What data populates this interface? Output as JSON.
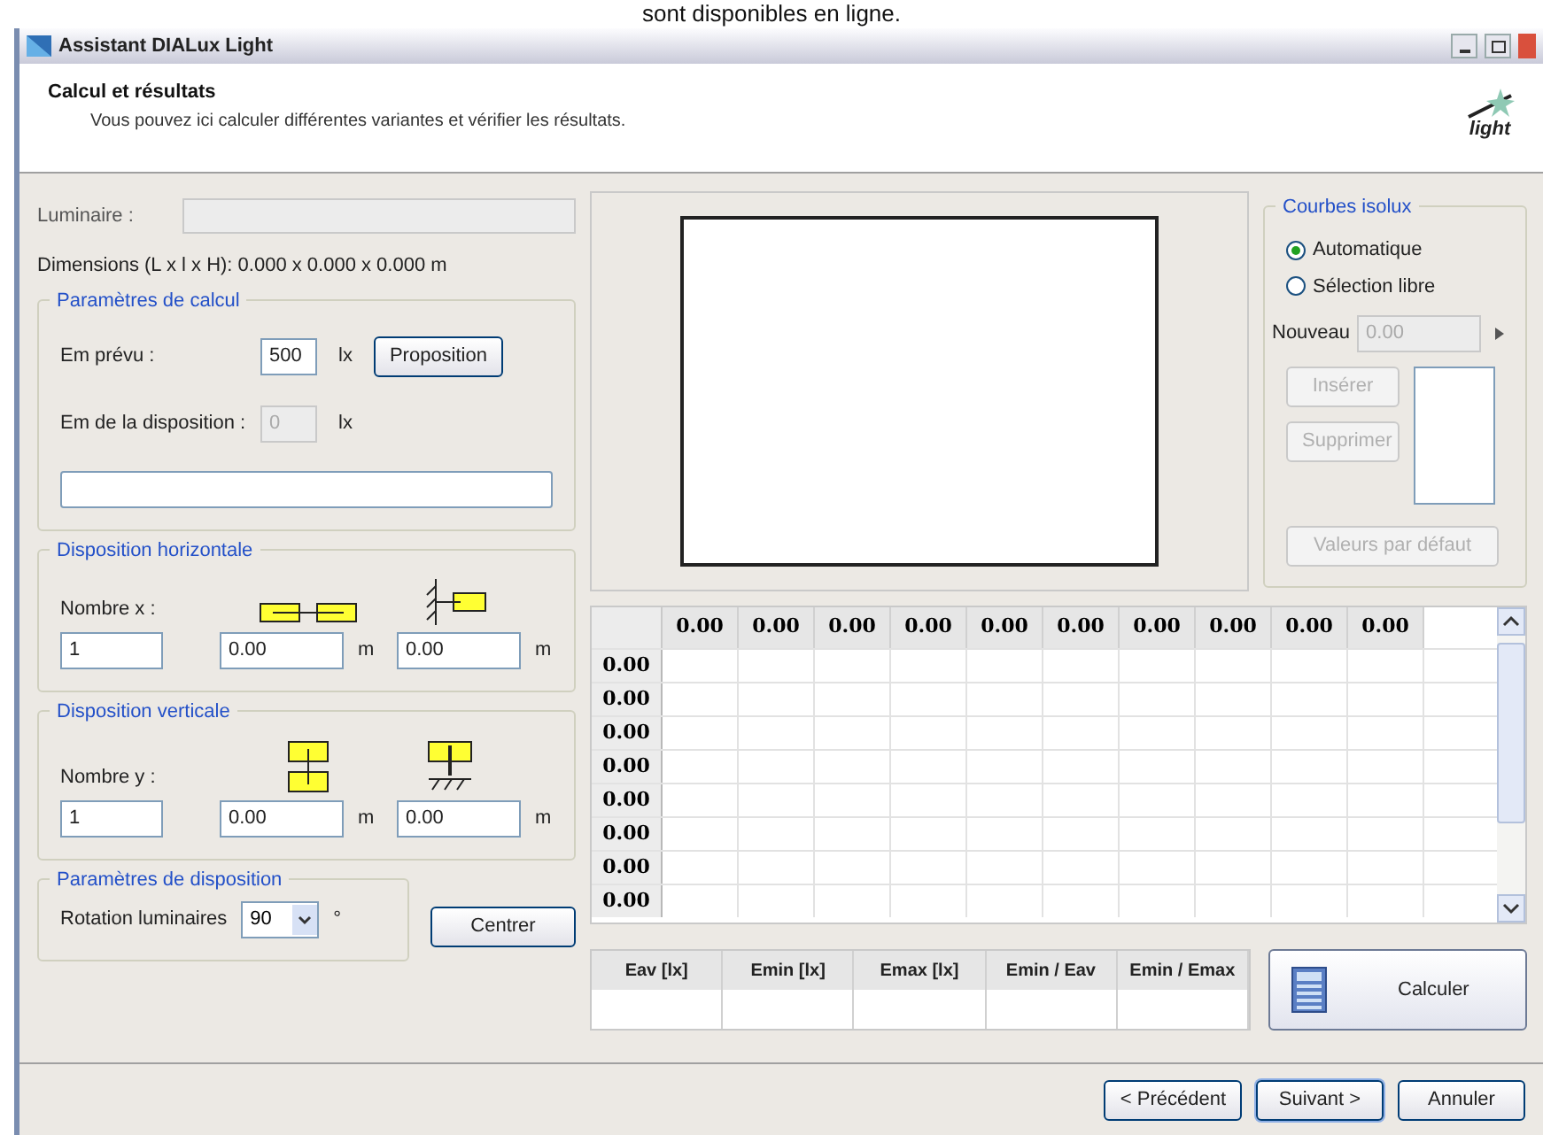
{
  "caption": "sont disponibles en ligne.",
  "window": {
    "title": "Assistant DIALux Light"
  },
  "header": {
    "title": "Calcul et résultats",
    "subtitle": "Vous pouvez ici calculer différentes variantes et vérifier les résultats.",
    "logo_text": "light"
  },
  "luminaire": {
    "label": "Luminaire :",
    "dimensions": "Dimensions (L x l x H): 0.000 x 0.000 x 0.000 m"
  },
  "calc_params": {
    "title": "Paramètres de calcul",
    "em_label": "Em prévu :",
    "em_value": "500",
    "em_unit": "lx",
    "proposal_button": "Proposition",
    "em_disp_label": "Em de la disposition :",
    "em_disp_value": "0",
    "em_disp_unit": "lx"
  },
  "horizontal": {
    "title": "Disposition horizontale",
    "count_label": "Nombre x :",
    "count": "1",
    "spacing": "0.00",
    "spacing_unit": "m",
    "wall": "0.00",
    "wall_unit": "m"
  },
  "vertical": {
    "title": "Disposition verticale",
    "count_label": "Nombre y :",
    "count": "1",
    "spacing": "0.00",
    "spacing_unit": "m",
    "wall": "0.00",
    "wall_unit": "m"
  },
  "layout_params": {
    "title": "Paramètres de disposition",
    "rotation_label": "Rotation luminaires",
    "rotation": "90",
    "rotation_unit": "°",
    "center_button": "Centrer"
  },
  "isolux": {
    "title": "Courbes isolux",
    "options": [
      {
        "label": "Automatique",
        "selected": true
      },
      {
        "label": "Sélection libre",
        "selected": false
      }
    ],
    "new_label": "Nouveau",
    "new_value": "0.00",
    "new_disabled": true,
    "insert": {
      "label": "Insérer",
      "disabled": true
    },
    "delete": {
      "label": "Supprimer",
      "disabled": true
    },
    "defaults": {
      "label": "Valeurs par défaut",
      "disabled": true
    }
  },
  "grid": {
    "columns": [
      "0.00",
      "0.00",
      "0.00",
      "0.00",
      "0.00",
      "0.00",
      "0.00",
      "0.00",
      "0.00",
      "0.00"
    ],
    "rows": [
      "0.00",
      "0.00",
      "0.00",
      "0.00",
      "0.00",
      "0.00",
      "0.00",
      "0.00"
    ]
  },
  "results": {
    "columns": [
      "Eav [lx]",
      "Emin [lx]",
      "Emax [lx]",
      "Emin / Eav",
      "Emin / Emax"
    ]
  },
  "calculate_button": "Calculer",
  "footer_buttons": [
    {
      "label": "< Précédent",
      "default": false
    },
    {
      "label": "Suivant >",
      "default": true
    },
    {
      "label": "Annuler",
      "default": false
    }
  ]
}
